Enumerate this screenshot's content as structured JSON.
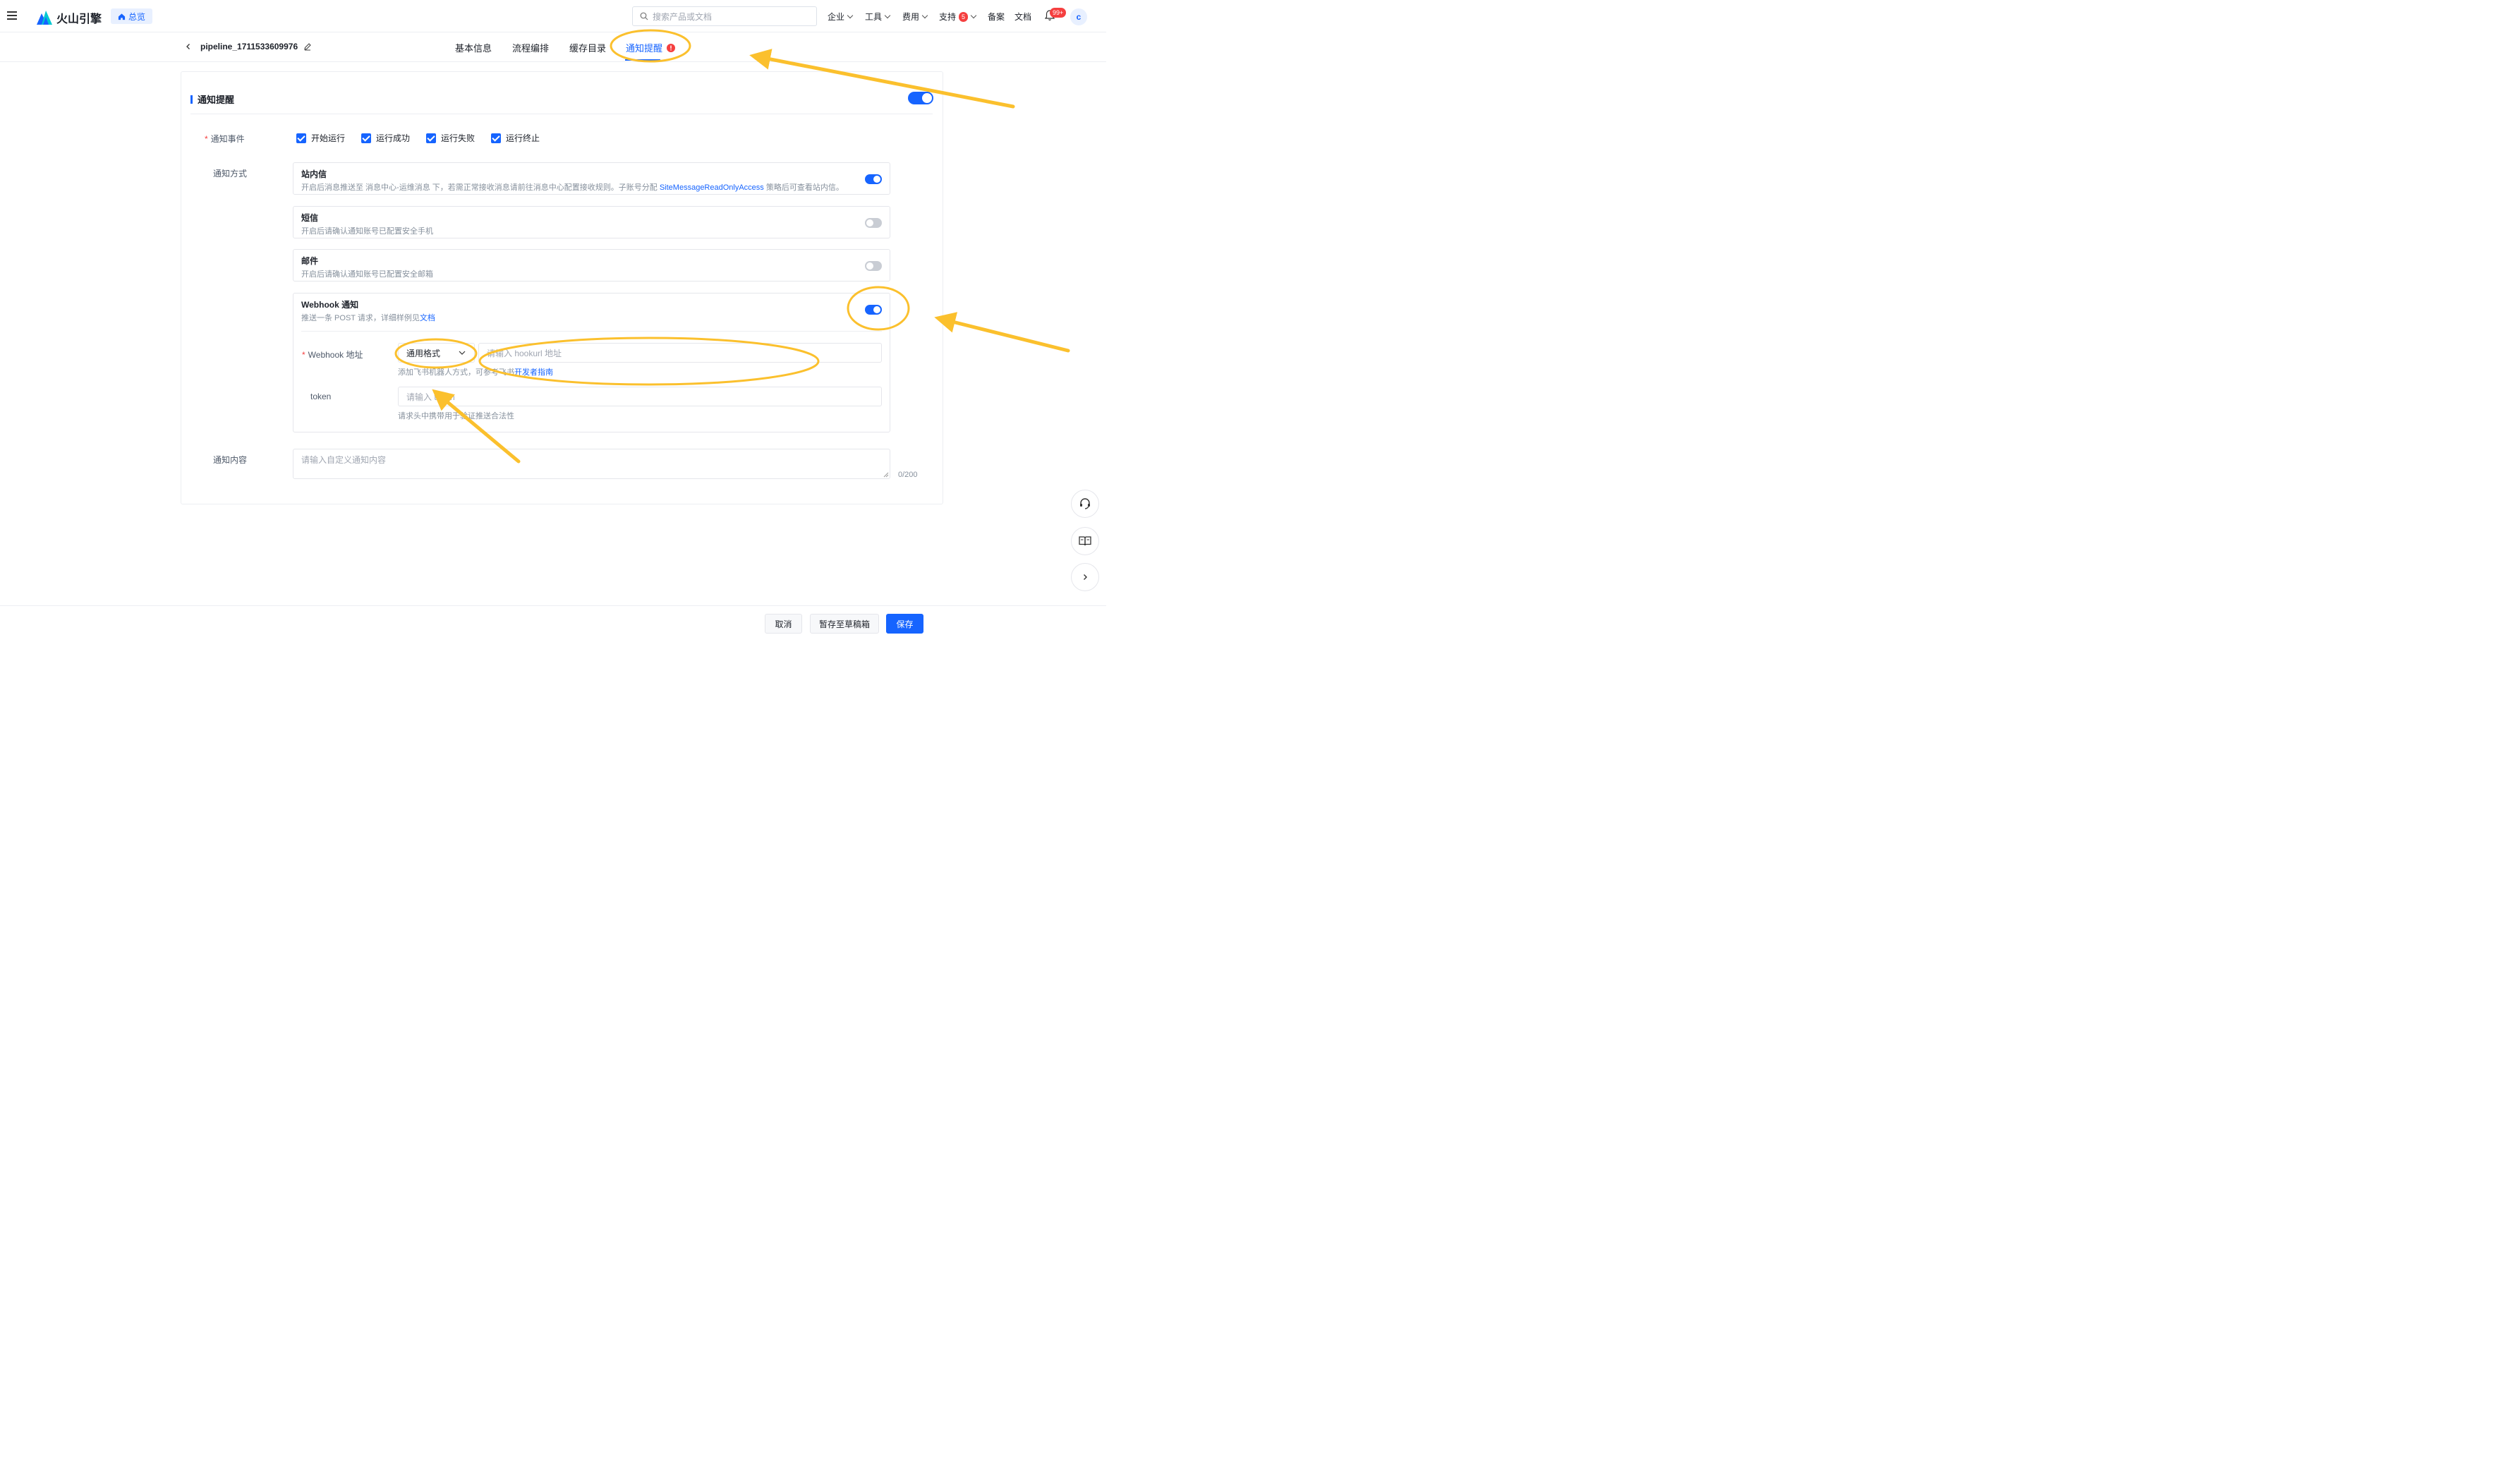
{
  "nav": {
    "brand": "火山引擎",
    "home_tag": "总览",
    "search_placeholder": "搜索产品或文档",
    "links": [
      "企业",
      "工具",
      "费用",
      "支持",
      "备案",
      "文档"
    ],
    "support_badge": "5",
    "notification_badge": "99+",
    "avatar_letter": "c"
  },
  "subheader": {
    "pipeline_name": "pipeline_1711533609976",
    "tabs": [
      "基本信息",
      "流程编排",
      "缓存目录",
      "通知提醒"
    ],
    "active_tab": "通知提醒"
  },
  "section": {
    "title": "通知提醒",
    "enabled": true
  },
  "events": {
    "label": "通知事件",
    "options": [
      {
        "label": "开始运行",
        "checked": true
      },
      {
        "label": "运行成功",
        "checked": true
      },
      {
        "label": "运行失败",
        "checked": true
      },
      {
        "label": "运行终止",
        "checked": true
      }
    ]
  },
  "methods": {
    "label": "通知方式",
    "channels": [
      {
        "title": "站内信",
        "desc": "开启后消息推送至 消息中心-运维消息 下，若需正常接收消息请前往消息中心配置接收规则。子账号分配",
        "desc_link": "SiteMessageReadOnlyAccess",
        "desc_tail": " 策略后可查看站内信。",
        "enabled": true
      },
      {
        "title": "短信",
        "desc": "开启后请确认通知账号已配置安全手机",
        "enabled": false
      },
      {
        "title": "邮件",
        "desc": "开启后请确认通知账号已配置安全邮箱",
        "enabled": false
      },
      {
        "title": "Webhook 通知",
        "desc": "推送一条 POST 请求，详细样例见",
        "desc_link": "文档",
        "enabled": true
      }
    ]
  },
  "webhook": {
    "address_label": "Webhook 地址",
    "format_value": "通用格式",
    "url_placeholder": "请输入 hookurl 地址",
    "url_hint": "添加飞书机器人方式，可参考飞书",
    "url_hint_link": "开发者指南",
    "token_label": "token",
    "token_placeholder": "请输入 token",
    "token_hint": "请求头中携带用于验证推送合法性"
  },
  "content": {
    "label": "通知内容",
    "placeholder": "请输入自定义通知内容",
    "counter": "0/200"
  },
  "footer": {
    "cancel": "取消",
    "draft": "暂存至草稿箱",
    "save": "保存"
  },
  "colors": {
    "primary": "#1664ff",
    "annotation": "#fbc02d",
    "required": "#f53f3f"
  }
}
